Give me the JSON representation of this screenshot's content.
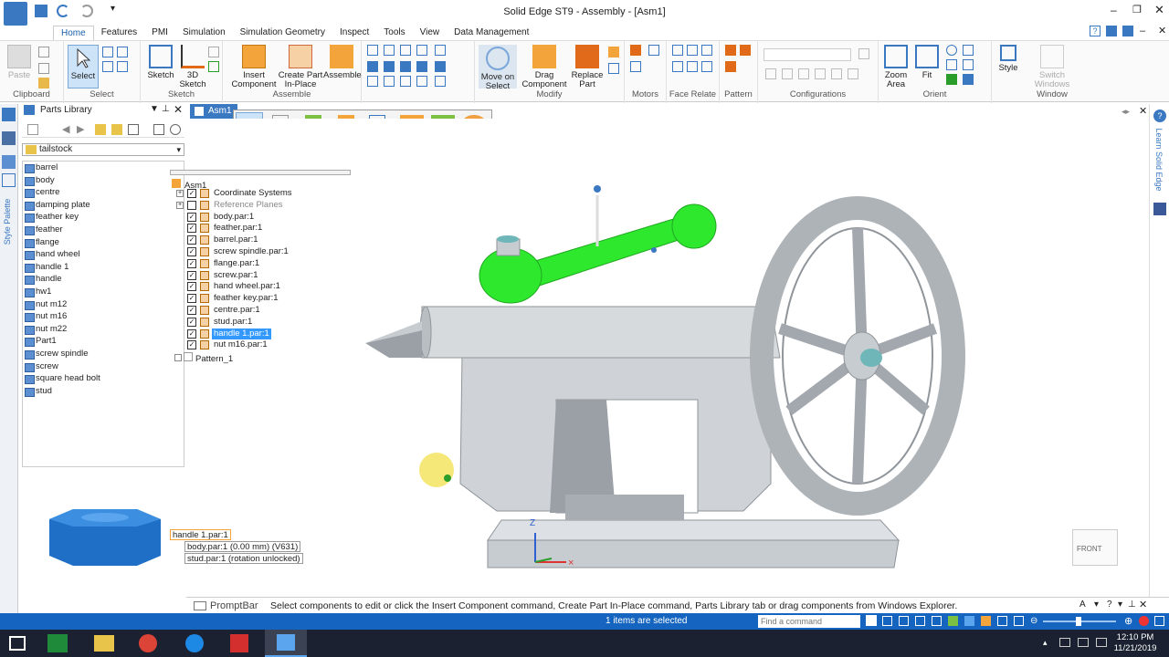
{
  "window": {
    "title": "Solid Edge ST9 - Assembly - [Asm1]"
  },
  "tabs": [
    "Home",
    "Features",
    "PMI",
    "Simulation",
    "Simulation Geometry",
    "Inspect",
    "Tools",
    "View",
    "Data Management"
  ],
  "ribbon": {
    "groups": [
      "Clipboard",
      "Select",
      "Sketch",
      "Assemble",
      "Modify",
      "Motors",
      "Face Relate",
      "Pattern",
      "Configurations",
      "Orient",
      "Window"
    ],
    "buttons": {
      "paste": "Paste",
      "select": "Select",
      "sketch": "Sketch",
      "sketch3d": "3D Sketch",
      "insert_component": "Insert Component",
      "create_part": "Create Part In-Place",
      "assemble": "Assemble",
      "move_on_select": "Move on Select",
      "drag_component": "Drag Component",
      "replace_part": "Replace Part",
      "zoom_area": "Zoom Area",
      "fit": "Fit",
      "style": "Style",
      "switch_windows": "Switch Windows"
    }
  },
  "parts_library": {
    "title": "Parts Library",
    "folder": "tailstock",
    "items": [
      "barrel",
      "body",
      "centre",
      "damping plate",
      "feather key",
      "feather",
      "flange",
      "hand wheel",
      "handle 1",
      "handle",
      "hw1",
      "nut m12",
      "nut m16",
      "nut m22",
      "Part1",
      "screw spindle",
      "screw",
      "square head bolt",
      "stud"
    ]
  },
  "document_tab": "Asm1",
  "side_strip_label": "Style Palette",
  "tree": {
    "root": "Asm1",
    "nodes": [
      {
        "label": "Coordinate Systems",
        "checked": true,
        "selected": false
      },
      {
        "label": "Reference Planes",
        "checked": false,
        "selected": false
      },
      {
        "label": "body.par:1",
        "checked": true,
        "selected": false
      },
      {
        "label": "feather.par:1",
        "checked": true,
        "selected": false
      },
      {
        "label": "barrel.par:1",
        "checked": true,
        "selected": false
      },
      {
        "label": "screw spindle.par:1",
        "checked": true,
        "selected": false
      },
      {
        "label": "flange.par:1",
        "checked": true,
        "selected": false
      },
      {
        "label": "screw.par:1",
        "checked": true,
        "selected": false
      },
      {
        "label": "hand wheel.par:1",
        "checked": true,
        "selected": false
      },
      {
        "label": "feather key.par:1",
        "checked": true,
        "selected": false
      },
      {
        "label": "centre.par:1",
        "checked": true,
        "selected": false
      },
      {
        "label": "stud.par:1",
        "checked": true,
        "selected": false
      },
      {
        "label": "handle 1.par:1",
        "checked": true,
        "selected": true
      },
      {
        "label": "nut m16.par:1",
        "checked": true,
        "selected": false
      }
    ],
    "pattern": "Pattern_1"
  },
  "relationships": {
    "part": "handle 1.par:1",
    "rows": [
      "body.par:1  (0.00 mm)  (V631)",
      "stud.par:1  (rotation unlocked)"
    ]
  },
  "viewport": {
    "triad_z": "Z",
    "view_cube_label": "FRONT"
  },
  "right_panel": {
    "label": "Learn Solid Edge"
  },
  "promptbar": {
    "label": "PromptBar",
    "message": "Select components to edit or click the Insert Component command, Create Part In-Place command, Parts Library tab or drag components from Windows Explorer."
  },
  "status": {
    "selected": "1 items are selected",
    "find_placeholder": "Find a command"
  },
  "clock": {
    "time": "12:10 PM",
    "date": "11/21/2019"
  },
  "colors": {
    "accent": "#1565c0",
    "selected": "#3399ff",
    "handle": "#2ee82e",
    "part_grey": "#c7ccd1"
  }
}
